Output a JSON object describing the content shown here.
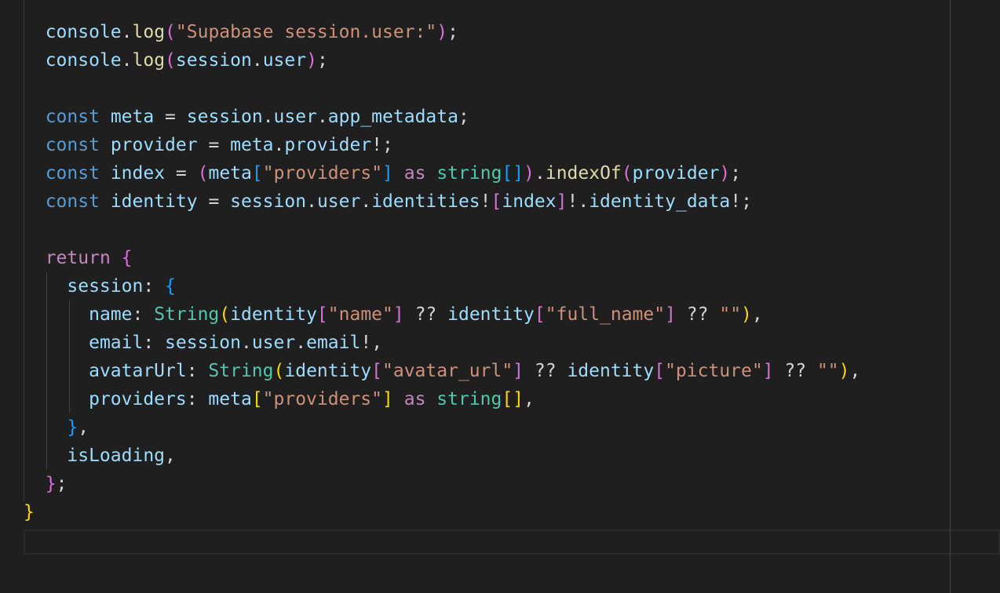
{
  "editor": {
    "language": "TypeScript",
    "lines": [
      {
        "guides": [],
        "tokens": [
          [
            "  ",
            "p"
          ],
          [
            "console",
            "var"
          ],
          [
            ".",
            "p"
          ],
          [
            "log",
            "fn"
          ],
          [
            "(",
            "b2"
          ],
          [
            "\"Supabase session.user:\"",
            "str"
          ],
          [
            ")",
            "b2"
          ],
          [
            ";",
            "p"
          ]
        ]
      },
      {
        "guides": [],
        "tokens": [
          [
            "  ",
            "p"
          ],
          [
            "console",
            "var"
          ],
          [
            ".",
            "p"
          ],
          [
            "log",
            "fn"
          ],
          [
            "(",
            "b2"
          ],
          [
            "session",
            "var"
          ],
          [
            ".",
            "p"
          ],
          [
            "user",
            "var"
          ],
          [
            ")",
            "b2"
          ],
          [
            ";",
            "p"
          ]
        ]
      },
      {
        "guides": [],
        "tokens": []
      },
      {
        "guides": [],
        "tokens": [
          [
            "  ",
            "p"
          ],
          [
            "const",
            "kw"
          ],
          [
            " ",
            "p"
          ],
          [
            "meta",
            "var"
          ],
          [
            " = ",
            "p"
          ],
          [
            "session",
            "var"
          ],
          [
            ".",
            "p"
          ],
          [
            "user",
            "var"
          ],
          [
            ".",
            "p"
          ],
          [
            "app_metadata",
            "var"
          ],
          [
            ";",
            "p"
          ]
        ]
      },
      {
        "guides": [],
        "tokens": [
          [
            "  ",
            "p"
          ],
          [
            "const",
            "kw"
          ],
          [
            " ",
            "p"
          ],
          [
            "provider",
            "var"
          ],
          [
            " = ",
            "p"
          ],
          [
            "meta",
            "var"
          ],
          [
            ".",
            "p"
          ],
          [
            "provider",
            "var"
          ],
          [
            "!;",
            "p"
          ]
        ]
      },
      {
        "guides": [],
        "tokens": [
          [
            "  ",
            "p"
          ],
          [
            "const",
            "kw"
          ],
          [
            " ",
            "p"
          ],
          [
            "index",
            "var"
          ],
          [
            " = ",
            "p"
          ],
          [
            "(",
            "b2"
          ],
          [
            "meta",
            "var"
          ],
          [
            "[",
            "b3"
          ],
          [
            "\"providers\"",
            "str"
          ],
          [
            "]",
            "b3"
          ],
          [
            " ",
            "p"
          ],
          [
            "as",
            "ctrl"
          ],
          [
            " ",
            "p"
          ],
          [
            "string",
            "type"
          ],
          [
            "[]",
            "b3"
          ],
          [
            ")",
            "b2"
          ],
          [
            ".",
            "p"
          ],
          [
            "indexOf",
            "fn"
          ],
          [
            "(",
            "b2"
          ],
          [
            "provider",
            "var"
          ],
          [
            ")",
            "b2"
          ],
          [
            ";",
            "p"
          ]
        ]
      },
      {
        "guides": [],
        "tokens": [
          [
            "  ",
            "p"
          ],
          [
            "const",
            "kw"
          ],
          [
            " ",
            "p"
          ],
          [
            "identity",
            "var"
          ],
          [
            " = ",
            "p"
          ],
          [
            "session",
            "var"
          ],
          [
            ".",
            "p"
          ],
          [
            "user",
            "var"
          ],
          [
            ".",
            "p"
          ],
          [
            "identities",
            "var"
          ],
          [
            "!",
            "p"
          ],
          [
            "[",
            "b2"
          ],
          [
            "index",
            "var"
          ],
          [
            "]",
            "b2"
          ],
          [
            "!.",
            "p"
          ],
          [
            "identity_data",
            "var"
          ],
          [
            "!;",
            "p"
          ]
        ]
      },
      {
        "guides": [],
        "tokens": []
      },
      {
        "guides": [],
        "tokens": [
          [
            "  ",
            "p"
          ],
          [
            "return",
            "ctrl"
          ],
          [
            " ",
            "p"
          ],
          [
            "{",
            "b2"
          ]
        ]
      },
      {
        "guides": [
          2
        ],
        "tokens": [
          [
            "    ",
            "p"
          ],
          [
            "session",
            "var"
          ],
          [
            ": ",
            "p"
          ],
          [
            "{",
            "b3"
          ]
        ]
      },
      {
        "guides": [
          2,
          4
        ],
        "tokens": [
          [
            "      ",
            "p"
          ],
          [
            "name",
            "var"
          ],
          [
            ": ",
            "p"
          ],
          [
            "String",
            "type"
          ],
          [
            "(",
            "b1"
          ],
          [
            "identity",
            "var"
          ],
          [
            "[",
            "b2"
          ],
          [
            "\"name\"",
            "str"
          ],
          [
            "]",
            "b2"
          ],
          [
            " ?? ",
            "p"
          ],
          [
            "identity",
            "var"
          ],
          [
            "[",
            "b2"
          ],
          [
            "\"full_name\"",
            "str"
          ],
          [
            "]",
            "b2"
          ],
          [
            " ?? ",
            "p"
          ],
          [
            "\"\"",
            "str"
          ],
          [
            ")",
            "b1"
          ],
          [
            ",",
            "p"
          ]
        ]
      },
      {
        "guides": [
          2,
          4
        ],
        "tokens": [
          [
            "      ",
            "p"
          ],
          [
            "email",
            "var"
          ],
          [
            ": ",
            "p"
          ],
          [
            "session",
            "var"
          ],
          [
            ".",
            "p"
          ],
          [
            "user",
            "var"
          ],
          [
            ".",
            "p"
          ],
          [
            "email",
            "var"
          ],
          [
            "!,",
            "p"
          ]
        ]
      },
      {
        "guides": [
          2,
          4
        ],
        "tokens": [
          [
            "      ",
            "p"
          ],
          [
            "avatarUrl",
            "var"
          ],
          [
            ": ",
            "p"
          ],
          [
            "String",
            "type"
          ],
          [
            "(",
            "b1"
          ],
          [
            "identity",
            "var"
          ],
          [
            "[",
            "b2"
          ],
          [
            "\"avatar_url\"",
            "str"
          ],
          [
            "]",
            "b2"
          ],
          [
            " ?? ",
            "p"
          ],
          [
            "identity",
            "var"
          ],
          [
            "[",
            "b2"
          ],
          [
            "\"picture\"",
            "str"
          ],
          [
            "]",
            "b2"
          ],
          [
            " ?? ",
            "p"
          ],
          [
            "\"\"",
            "str"
          ],
          [
            ")",
            "b1"
          ],
          [
            ",",
            "p"
          ]
        ]
      },
      {
        "guides": [
          2,
          4
        ],
        "tokens": [
          [
            "      ",
            "p"
          ],
          [
            "providers",
            "var"
          ],
          [
            ": ",
            "p"
          ],
          [
            "meta",
            "var"
          ],
          [
            "[",
            "b1"
          ],
          [
            "\"providers\"",
            "str"
          ],
          [
            "]",
            "b1"
          ],
          [
            " ",
            "p"
          ],
          [
            "as",
            "ctrl"
          ],
          [
            " ",
            "p"
          ],
          [
            "string",
            "type"
          ],
          [
            "[]",
            "b1"
          ],
          [
            ",",
            "p"
          ]
        ]
      },
      {
        "guides": [
          2
        ],
        "tokens": [
          [
            "    ",
            "p"
          ],
          [
            "}",
            "b3"
          ],
          [
            ",",
            "p"
          ]
        ]
      },
      {
        "guides": [
          2
        ],
        "tokens": [
          [
            "    ",
            "p"
          ],
          [
            "isLoading",
            "var"
          ],
          [
            ",",
            "p"
          ]
        ]
      },
      {
        "guides": [],
        "tokens": [
          [
            "  ",
            "p"
          ],
          [
            "}",
            "b2"
          ],
          [
            ";",
            "p"
          ]
        ]
      },
      {
        "guides": [],
        "tokens": [
          [
            "}",
            "b1"
          ]
        ]
      }
    ]
  }
}
